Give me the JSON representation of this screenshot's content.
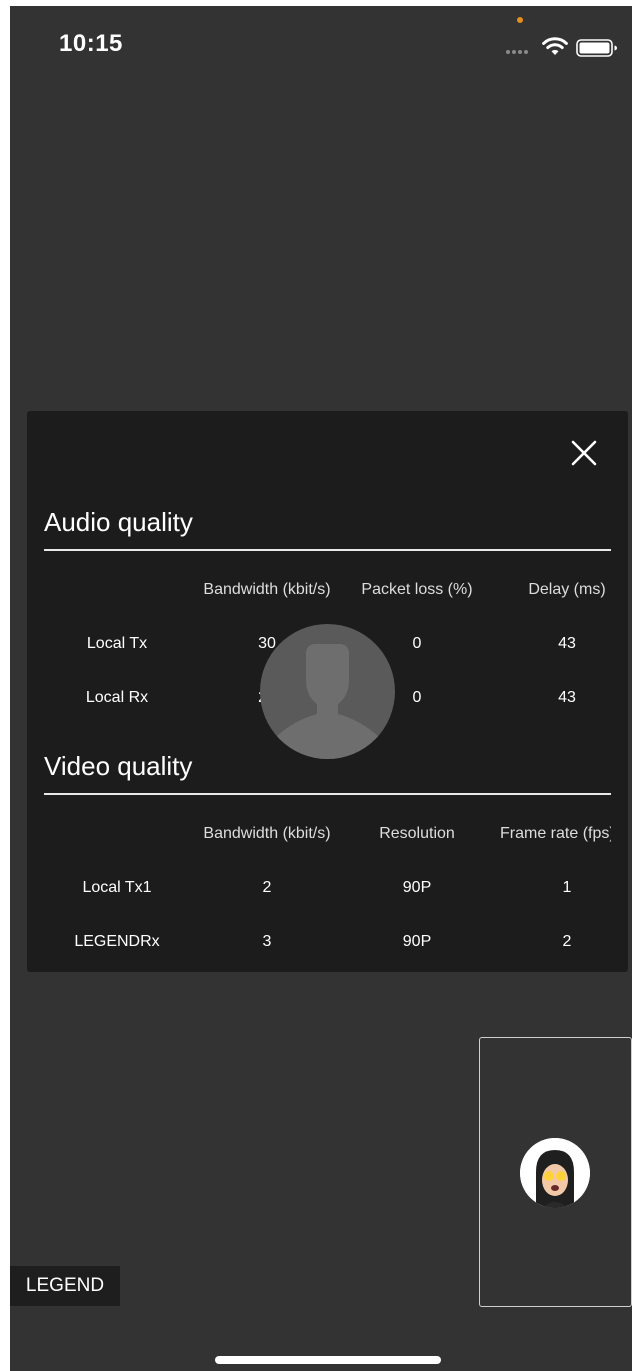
{
  "status_bar": {
    "time": "10:15"
  },
  "panel": {
    "close_icon": "close-icon",
    "audio": {
      "title": "Audio quality",
      "headers": [
        "Bandwidth (kbit/s)",
        "Packet loss (%)",
        "Delay (ms)"
      ],
      "rows": [
        {
          "label": "Local Tx",
          "c1": "30",
          "c2": "0",
          "c3": "43"
        },
        {
          "label": "Local Rx",
          "c1": "25",
          "c2": "0",
          "c3": "43"
        }
      ]
    },
    "video": {
      "title": "Video quality",
      "headers": [
        "Bandwidth (kbit/s)",
        "Resolution",
        "Frame rate (fps)"
      ],
      "rows": [
        {
          "label": "Local Tx1",
          "c1": "2",
          "c2": "90P",
          "c3": "1"
        },
        {
          "label": "LEGENDRx",
          "c1": "3",
          "c2": "90P",
          "c3": "2"
        }
      ]
    }
  },
  "remote_video": {
    "avatar_icon": "person-silhouette-icon"
  },
  "local_preview": {
    "avatar_icon": "memoji-avatar-icon"
  },
  "legend_label": "LEGEND",
  "colors": {
    "background": "#333333",
    "panel": "#1c1c1c",
    "status_dot": "#e2901a"
  }
}
